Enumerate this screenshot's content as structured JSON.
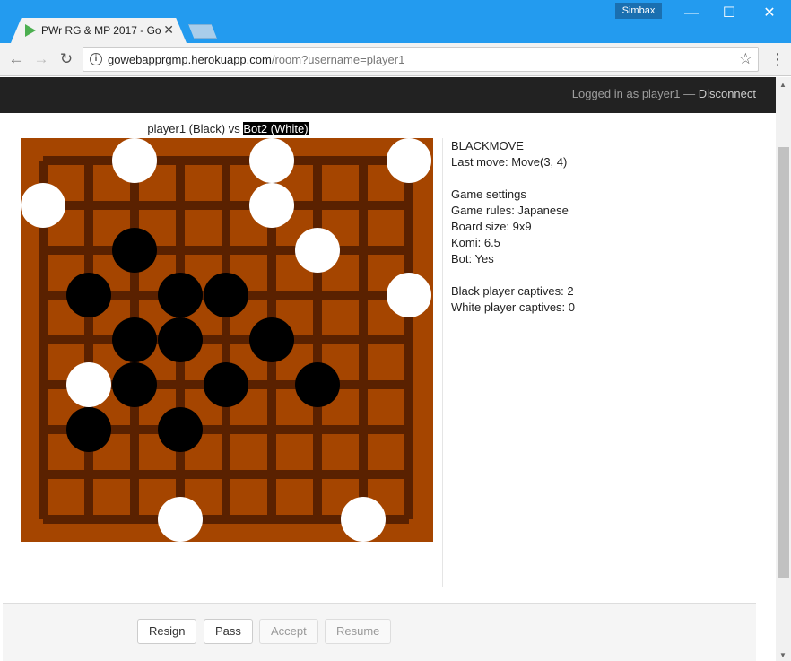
{
  "browser": {
    "tab_title": "PWr RG & MP 2017 - Go",
    "tab_close": "✕",
    "profile_name": "Simbax",
    "window_min": "—",
    "window_max": "☐",
    "window_close": "✕",
    "back": "←",
    "forward": "→",
    "reload": "↻",
    "info": "i",
    "url_host": "gowebapprgmp.herokuapp.com",
    "url_path": "/room?username=player1",
    "star": "☆",
    "menu": "⋮"
  },
  "navbar": {
    "logged_in_text": "Logged in as player1 — ",
    "disconnect_label": "Disconnect"
  },
  "game": {
    "players_prefix": "player1 (Black) vs ",
    "players_highlight": "Bot2 (White)",
    "status": "BLACKMOVE",
    "last_move": "Last move: Move(3, 4)",
    "settings_heading": "Game settings",
    "rules": "Game rules: Japanese",
    "board_size_label": "Board size: 9x9",
    "komi": "Komi: 6.5",
    "bot": "Bot: Yes",
    "black_captives": "Black player captives: 2",
    "white_captives": "White player captives: 0",
    "board": {
      "size": 9,
      "board_color": "#a54500",
      "grid_color": "#5a2100",
      "stones": [
        {
          "color": "white",
          "col": 2,
          "row": 0
        },
        {
          "color": "white",
          "col": 5,
          "row": 0
        },
        {
          "color": "white",
          "col": 8,
          "row": 0
        },
        {
          "color": "white",
          "col": 0,
          "row": 1
        },
        {
          "color": "white",
          "col": 5,
          "row": 1
        },
        {
          "color": "black",
          "col": 2,
          "row": 2
        },
        {
          "color": "white",
          "col": 6,
          "row": 2
        },
        {
          "color": "black",
          "col": 1,
          "row": 3
        },
        {
          "color": "black",
          "col": 3,
          "row": 3
        },
        {
          "color": "black",
          "col": 4,
          "row": 3
        },
        {
          "color": "white",
          "col": 8,
          "row": 3
        },
        {
          "color": "black",
          "col": 2,
          "row": 4
        },
        {
          "color": "black",
          "col": 3,
          "row": 4
        },
        {
          "color": "black",
          "col": 5,
          "row": 4
        },
        {
          "color": "white",
          "col": 1,
          "row": 5
        },
        {
          "color": "black",
          "col": 2,
          "row": 5
        },
        {
          "color": "black",
          "col": 4,
          "row": 5
        },
        {
          "color": "black",
          "col": 6,
          "row": 5
        },
        {
          "color": "black",
          "col": 1,
          "row": 6
        },
        {
          "color": "black",
          "col": 3,
          "row": 6
        },
        {
          "color": "white",
          "col": 3,
          "row": 8
        },
        {
          "color": "white",
          "col": 7,
          "row": 8
        }
      ]
    }
  },
  "actions": {
    "resign_label": "Resign",
    "pass_label": "Pass",
    "accept_label": "Accept",
    "resume_label": "Resume"
  }
}
